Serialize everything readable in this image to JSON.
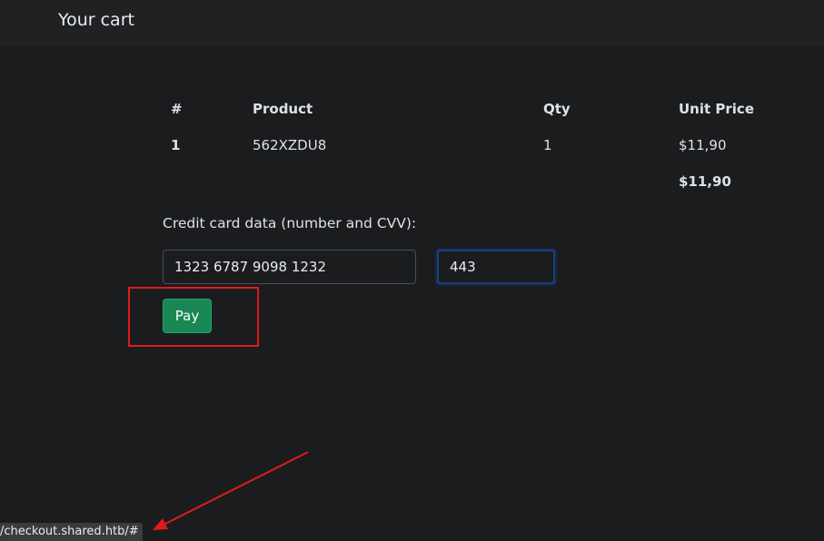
{
  "header": {
    "title": "Your cart"
  },
  "cart": {
    "columns": [
      "#",
      "Product",
      "Qty",
      "Unit Price"
    ],
    "rows": [
      {
        "index": "1",
        "product": "562XZDU8",
        "qty": "1",
        "unit_price": "$11,90"
      }
    ],
    "total": "$11,90"
  },
  "payment": {
    "label": "Credit card data (number and CVV):",
    "card_number": "1323 6787 9098 1232",
    "cvv": "443",
    "pay_label": "Pay"
  },
  "status_bar": {
    "url": "/checkout.shared.htb/#"
  },
  "annotations": {
    "color": "#e01b1b"
  }
}
